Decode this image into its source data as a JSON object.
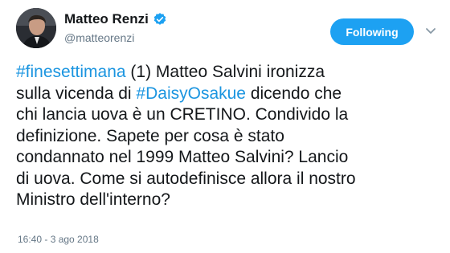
{
  "author": {
    "name": "Matteo Renzi",
    "handle": "@matteorenzi",
    "verified_color": "#1da1f2"
  },
  "follow_button": {
    "label": "Following",
    "color": "#1da1f2"
  },
  "menu_icon": "chevron-down-icon",
  "tweet": {
    "lines": [
      [
        {
          "t": "#finesettimana",
          "tag": true
        },
        {
          "t": " (1) Matteo Salvini ironizza",
          "tag": false
        }
      ],
      [
        {
          "t": "sulla vicenda di ",
          "tag": false
        },
        {
          "t": "#DaisyOsakue",
          "tag": true
        },
        {
          "t": " dicendo che",
          "tag": false
        }
      ],
      [
        {
          "t": "chi lancia uova è un CRETINO. Condivido la",
          "tag": false
        }
      ],
      [
        {
          "t": "definizione. Sapete per cosa è stato",
          "tag": false
        }
      ],
      [
        {
          "t": "condannato nel 1999 Matteo Salvini? Lancio",
          "tag": false
        }
      ],
      [
        {
          "t": "di uova. Come si autodefinisce allora il nostro",
          "tag": false
        }
      ],
      [
        {
          "t": "Ministro dell'interno?",
          "tag": false
        }
      ]
    ],
    "hashtag_color": "#1b95e0",
    "timestamp": "16:40 - 3 ago 2018"
  }
}
